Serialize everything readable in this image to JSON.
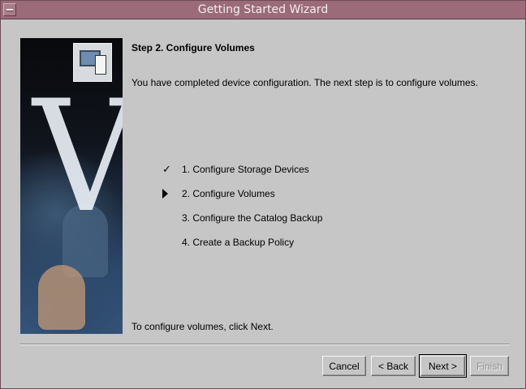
{
  "window": {
    "title": "Getting Started Wizard"
  },
  "sidebar": {
    "image_icon": "wizard-banner-image"
  },
  "content": {
    "heading": "Step 2. Configure Volumes",
    "description": "You have completed device configuration.  The next step is to configure volumes.",
    "steps": [
      {
        "mark": "check",
        "label": "1.  Configure Storage Devices"
      },
      {
        "mark": "arrow",
        "label": "2.  Configure Volumes"
      },
      {
        "mark": "",
        "label": "3.  Configure the Catalog Backup"
      },
      {
        "mark": "",
        "label": "4.  Create a Backup Policy"
      }
    ],
    "footer": "To configure volumes, click Next."
  },
  "buttons": {
    "cancel": "Cancel",
    "back": "< Back",
    "next": "Next >",
    "finish": "Finish"
  },
  "colors": {
    "titlebar": "#9b6b79",
    "window_bg": "#c6c6c6"
  }
}
